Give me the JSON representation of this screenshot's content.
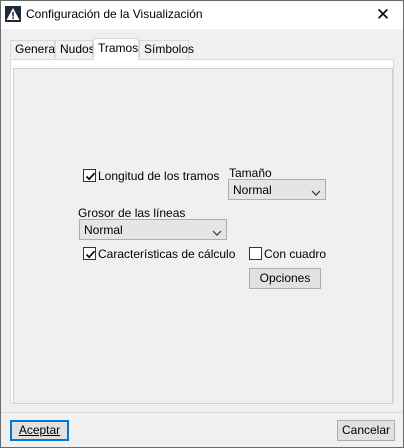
{
  "window": {
    "title": "Configuración de la Visualización"
  },
  "tabs": [
    {
      "label": "General",
      "active": false
    },
    {
      "label": "Nudos",
      "active": false
    },
    {
      "label": "Tramos",
      "active": true
    },
    {
      "label": "Símbolos",
      "active": false
    }
  ],
  "tramos": {
    "longitud": {
      "label": "Longitud de los tramos",
      "checked": true
    },
    "tamano": {
      "label": "Tamaño",
      "value": "Normal"
    },
    "grosor": {
      "label": "Grosor de las líneas",
      "value": "Normal"
    },
    "calculo": {
      "label": "Características de cálculo",
      "checked": true
    },
    "cuadro": {
      "label": "Con cuadro",
      "checked": false
    },
    "opciones_label": "Opciones"
  },
  "footer": {
    "accept_label": "Aceptar",
    "cancel_label": "Cancelar"
  },
  "colors": {
    "focus_border": "#0078d7",
    "check_mark": "#000000"
  }
}
